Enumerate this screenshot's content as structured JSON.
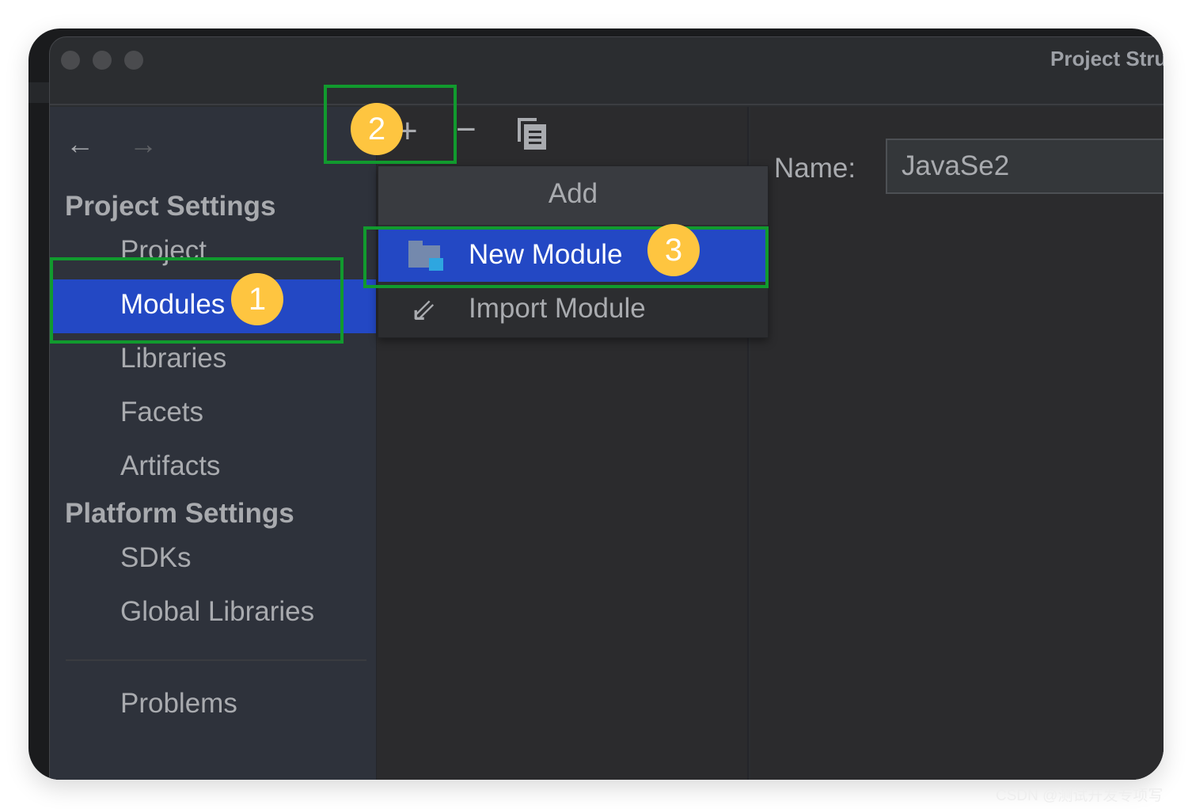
{
  "window": {
    "title": "Project Structure"
  },
  "nav": {
    "back": "back-arrow-icon",
    "forward": "forward-arrow-icon"
  },
  "sidebar": {
    "project_settings": "Project Settings",
    "items": [
      {
        "label": "Project"
      },
      {
        "label": "Modules"
      },
      {
        "label": "Libraries"
      },
      {
        "label": "Facets"
      },
      {
        "label": "Artifacts"
      }
    ],
    "platform_settings": "Platform Settings",
    "platform_items": [
      {
        "label": "SDKs"
      },
      {
        "label": "Global Libraries"
      }
    ],
    "problems": "Problems"
  },
  "toolbar": {
    "add": "+",
    "remove": "−",
    "copy": "copy-icon"
  },
  "popup": {
    "title": "Add",
    "items": [
      {
        "label": "New Module",
        "icon": "folder-module-icon"
      },
      {
        "label": "Import Module",
        "icon": "import-arrow-icon"
      }
    ]
  },
  "detail": {
    "name_label": "Name:",
    "name_value": "JavaSe2"
  },
  "annotations": [
    "1",
    "2",
    "3"
  ],
  "colors": {
    "selection": "#2348c4",
    "highlight_box": "#119a2e",
    "badge": "#fec540"
  },
  "watermark": "CSDN @测试开发专项写"
}
